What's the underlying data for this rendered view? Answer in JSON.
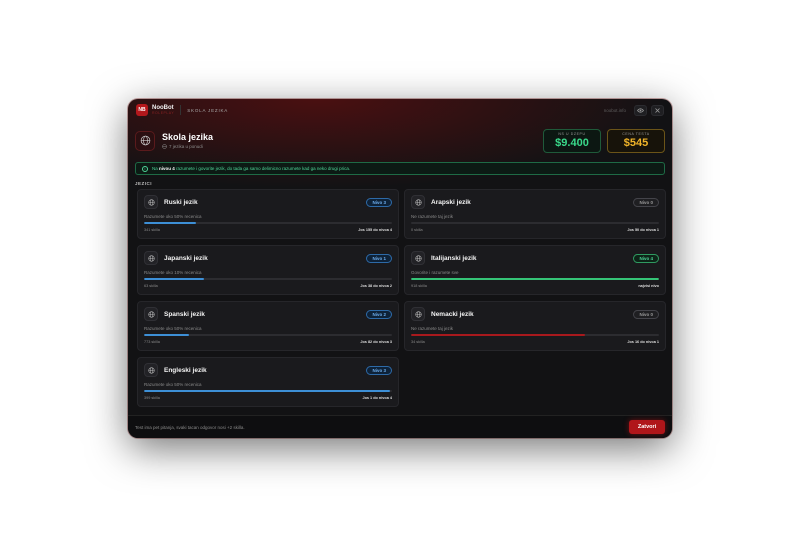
{
  "topbar": {
    "logo": "NB",
    "brand_name": "NooBot",
    "brand_sub": "ROLEPLAY",
    "section_title": "SKOLA JEZIKA",
    "site": "noobot.info",
    "view_icon": "eye-icon",
    "close_icon": "close-icon"
  },
  "header": {
    "icon": "globe-icon",
    "title": "Skola jezika",
    "subtitle": "7 jezika u ponudi",
    "money_label": "NS U DZEPU",
    "money_value": "$9.400",
    "price_label": "CENA TESTA",
    "price_value": "$545"
  },
  "info": {
    "prefix": "Na",
    "highlight": "nivou 4",
    "suffix": "razumete i govorite jezik, do tada ga samo delimicno razumete kad ga neko drugi prica."
  },
  "langs_label": "JEZICI",
  "languages": [
    {
      "name": "Ruski jezik",
      "level": "Nivo 3",
      "status": "blue",
      "desc": "Razumete oko 50% recenica",
      "skills": "341 skilla",
      "next": "Jos 155 do nivoa 4",
      "progress": 0.21
    },
    {
      "name": "Arapski jezik",
      "level": "Nivo 0",
      "status": "gray",
      "desc": "Ne razumete taj jezik",
      "skills": "0 skilla",
      "next": "Jos 50 do nivoa 1",
      "progress": 0
    },
    {
      "name": "Japanski jezik",
      "level": "Nivo 1",
      "status": "blue",
      "desc": "Razumete oko 10% recenica",
      "skills": "63 skilla",
      "next": "Jos 38 do nivoa 2",
      "progress": 0.24
    },
    {
      "name": "Italijanski jezik",
      "level": "Nivo 4",
      "status": "green",
      "desc": "Govorite i razumete sve",
      "skills": "918 skilla",
      "next": "najvisi nivo",
      "progress": 1
    },
    {
      "name": "Spanski jezik",
      "level": "Nivo 2",
      "status": "blue",
      "desc": "Razumete oko 50% recenica",
      "skills": "773 skilla",
      "next": "Jos 82 do nivoa 3",
      "progress": 0.18
    },
    {
      "name": "Nemacki jezik",
      "level": "Nivo 0",
      "status": "red",
      "desc": "Ne razumete taj jezik",
      "skills": "34 skilla",
      "next": "Jos 16 do nivoa 1",
      "progress": 0.7
    },
    {
      "name": "Engleski jezik",
      "level": "Nivo 3",
      "status": "blue",
      "desc": "Razumete oko 50% recenica",
      "skills": "399 skilla",
      "next": "Jos 1 do nivoa 4",
      "progress": 0.99
    }
  ],
  "footer": {
    "text": "Test ima pet pitanja, svaki tacan odgovor nosi +2 skilla.",
    "close_label": "Zatvori"
  },
  "colors": {
    "accent_red": "#b0161a",
    "money_green": "#39d98a",
    "price_gold": "#f0b429",
    "level_blue": "#3d8fd6"
  }
}
